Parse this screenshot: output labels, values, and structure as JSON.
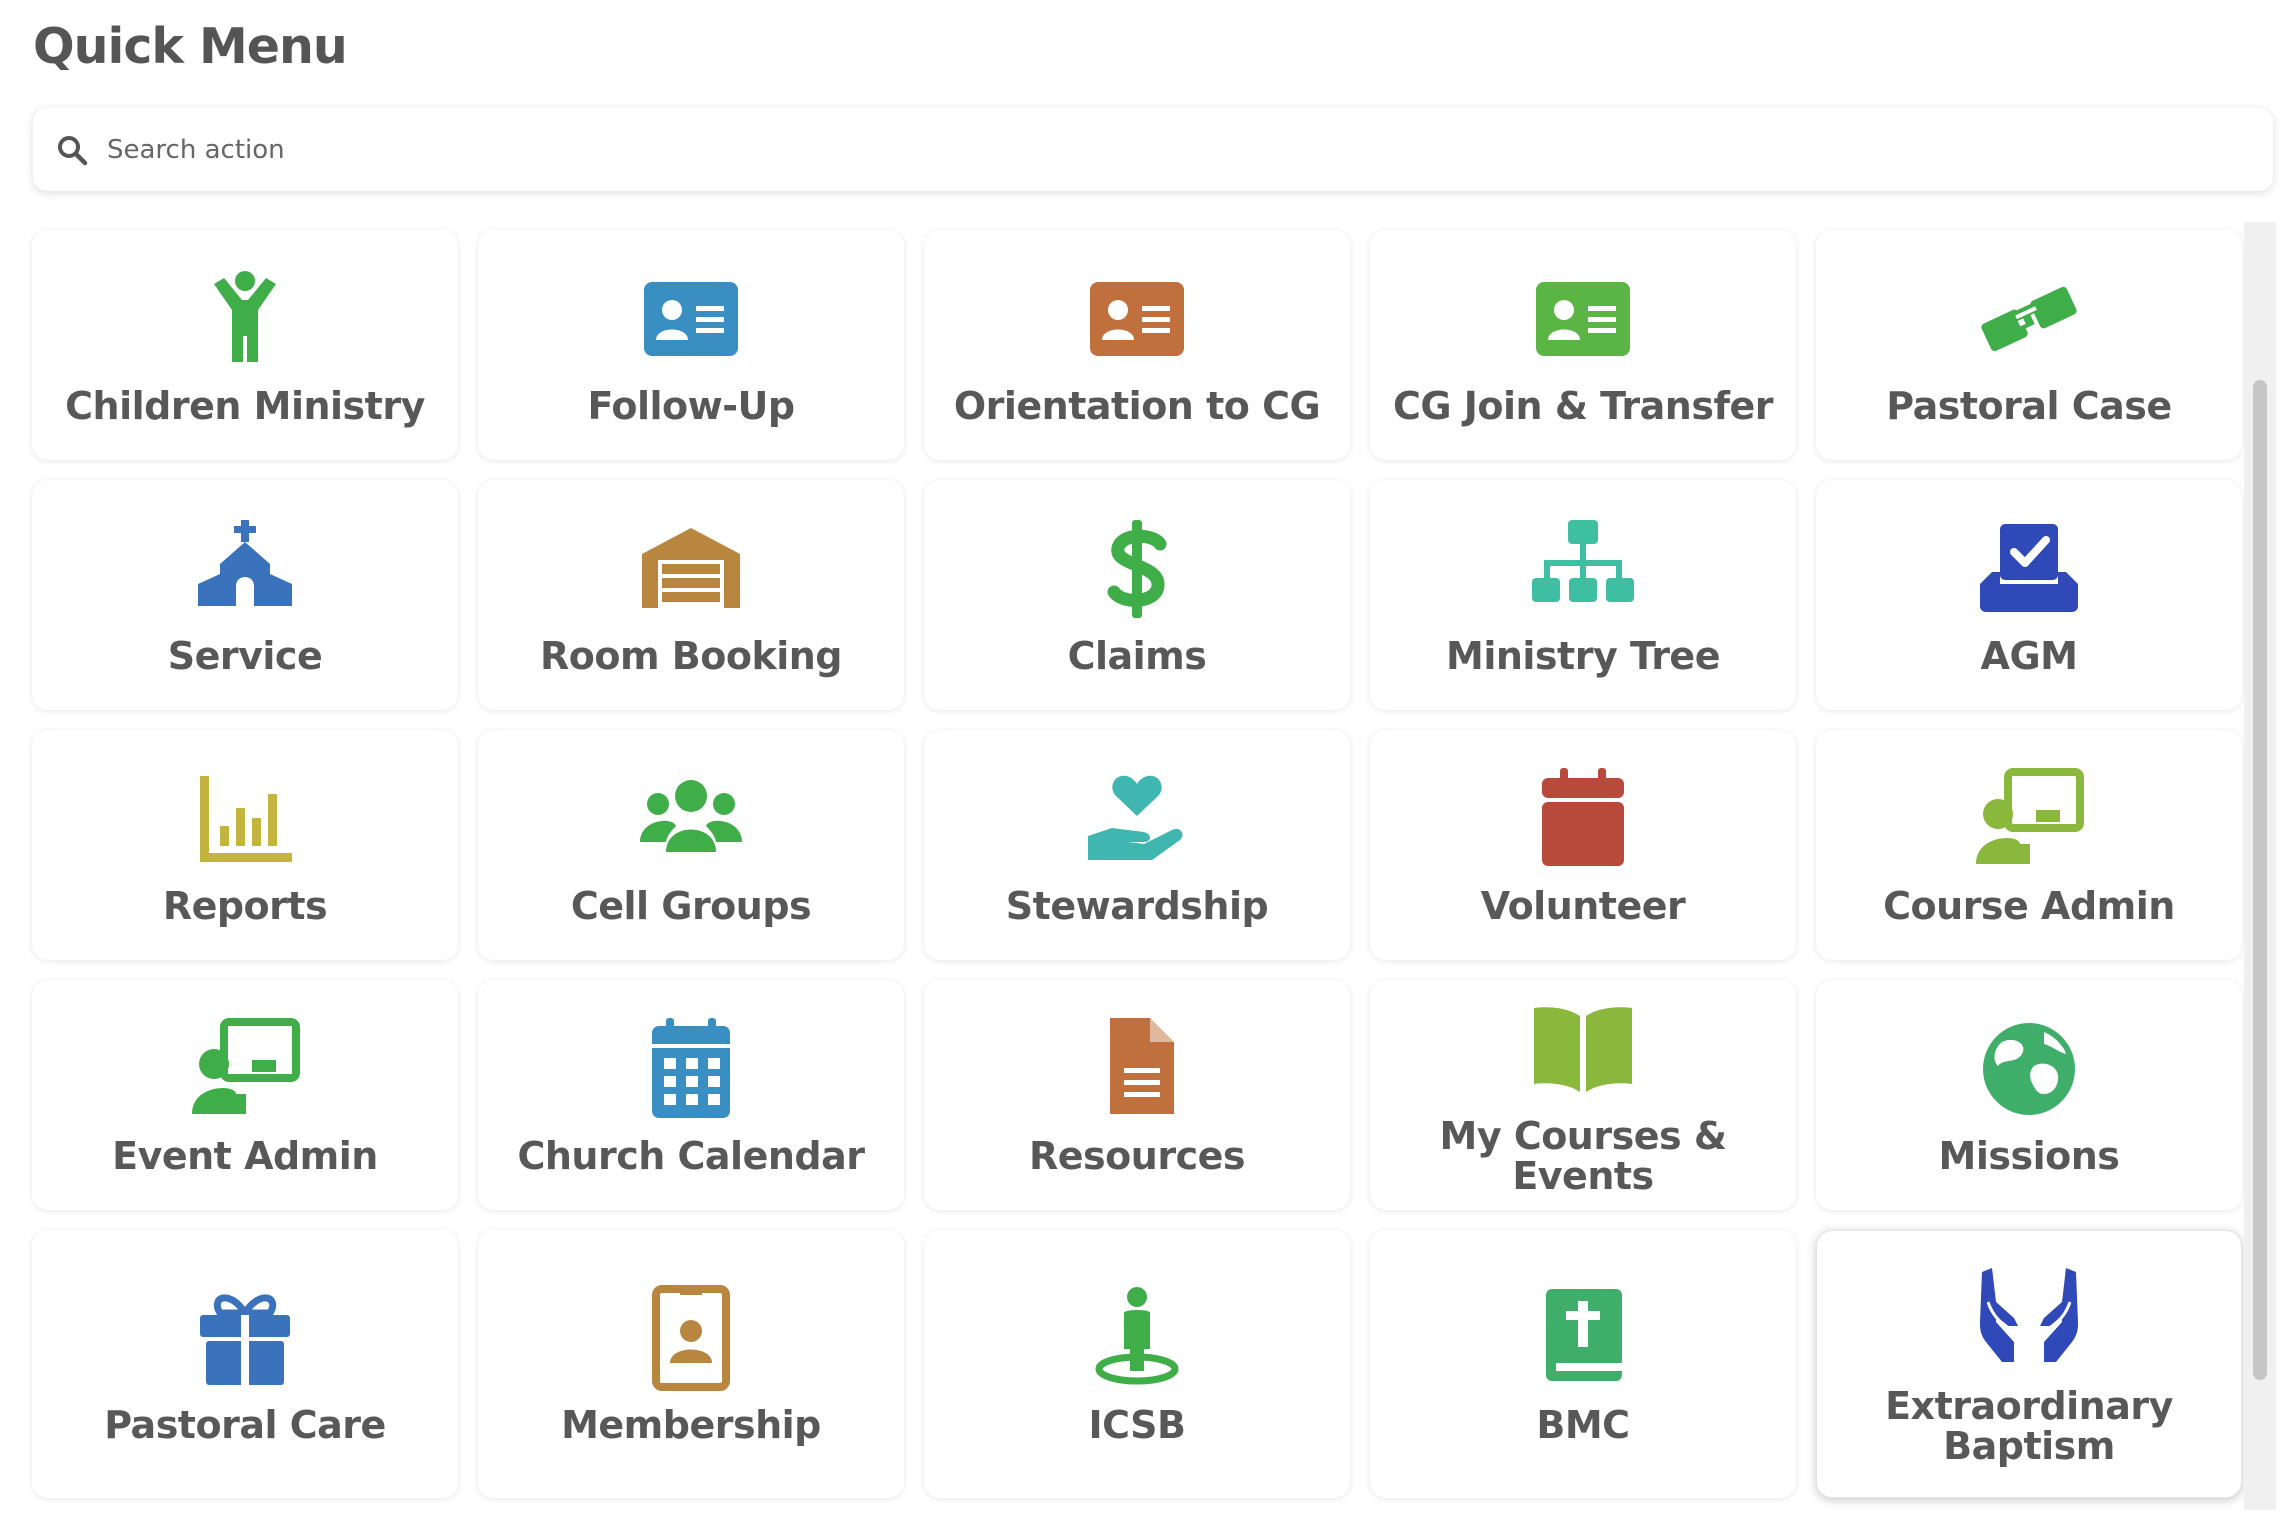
{
  "header": {
    "title": "Quick Menu"
  },
  "search": {
    "placeholder": "Search action",
    "value": "",
    "icon": "search-icon"
  },
  "menu": {
    "items": [
      {
        "id": "children-ministry",
        "label": "Children Ministry",
        "icon": "child-icon",
        "color": "#3fae49"
      },
      {
        "id": "follow-up",
        "label": "Follow-Up",
        "icon": "id-card-icon",
        "color": "#3a8fc2"
      },
      {
        "id": "orientation-to-cg",
        "label": "Orientation to CG",
        "icon": "id-card-icon",
        "color": "#c0703d"
      },
      {
        "id": "cg-join-transfer",
        "label": "CG Join & Transfer",
        "icon": "id-card-icon",
        "color": "#5ab544"
      },
      {
        "id": "pastoral-case",
        "label": "Pastoral Case",
        "icon": "handshake-icon",
        "color": "#3fae49"
      },
      {
        "id": "service",
        "label": "Service",
        "icon": "church-icon",
        "color": "#3a73bb"
      },
      {
        "id": "room-booking",
        "label": "Room Booking",
        "icon": "warehouse-icon",
        "color": "#b8863e"
      },
      {
        "id": "claims",
        "label": "Claims",
        "icon": "dollar-icon",
        "color": "#3fae49"
      },
      {
        "id": "ministry-tree",
        "label": "Ministry Tree",
        "icon": "sitemap-icon",
        "color": "#3fbfa2"
      },
      {
        "id": "agm",
        "label": "AGM",
        "icon": "vote-icon",
        "color": "#2f4ab8"
      },
      {
        "id": "reports",
        "label": "Reports",
        "icon": "chart-bar-icon",
        "color": "#c2b43c"
      },
      {
        "id": "cell-groups",
        "label": "Cell Groups",
        "icon": "users-icon",
        "color": "#3fae49"
      },
      {
        "id": "stewardship",
        "label": "Stewardship",
        "icon": "hand-heart-icon",
        "color": "#3fb6b0"
      },
      {
        "id": "volunteer",
        "label": "Volunteer",
        "icon": "calendar-icon",
        "color": "#b84a3c"
      },
      {
        "id": "course-admin",
        "label": "Course Admin",
        "icon": "teacher-icon",
        "color": "#8ab83c"
      },
      {
        "id": "event-admin",
        "label": "Event Admin",
        "icon": "teacher-icon",
        "color": "#3fae49"
      },
      {
        "id": "church-calendar",
        "label": "Church Calendar",
        "icon": "calendar-grid-icon",
        "color": "#3a8fc2"
      },
      {
        "id": "resources",
        "label": "Resources",
        "icon": "file-icon",
        "color": "#c0703d"
      },
      {
        "id": "my-courses-events",
        "label": "My Courses & Events",
        "icon": "book-open-icon",
        "color": "#8ab83c"
      },
      {
        "id": "missions",
        "label": "Missions",
        "icon": "globe-icon",
        "color": "#3fae6a"
      },
      {
        "id": "pastoral-care",
        "label": "Pastoral Care",
        "icon": "gift-icon",
        "color": "#3a73bb"
      },
      {
        "id": "membership",
        "label": "Membership",
        "icon": "id-badge-icon",
        "color": "#b8863e"
      },
      {
        "id": "icsb",
        "label": "ICSB",
        "icon": "person-podium-icon",
        "color": "#3fae49"
      },
      {
        "id": "bmc",
        "label": "BMC",
        "icon": "bible-icon",
        "color": "#3fae6a"
      },
      {
        "id": "extraordinary-baptism",
        "label": "Extraordinary Baptism",
        "icon": "hands-icon",
        "color": "#2f4ab8"
      }
    ]
  }
}
